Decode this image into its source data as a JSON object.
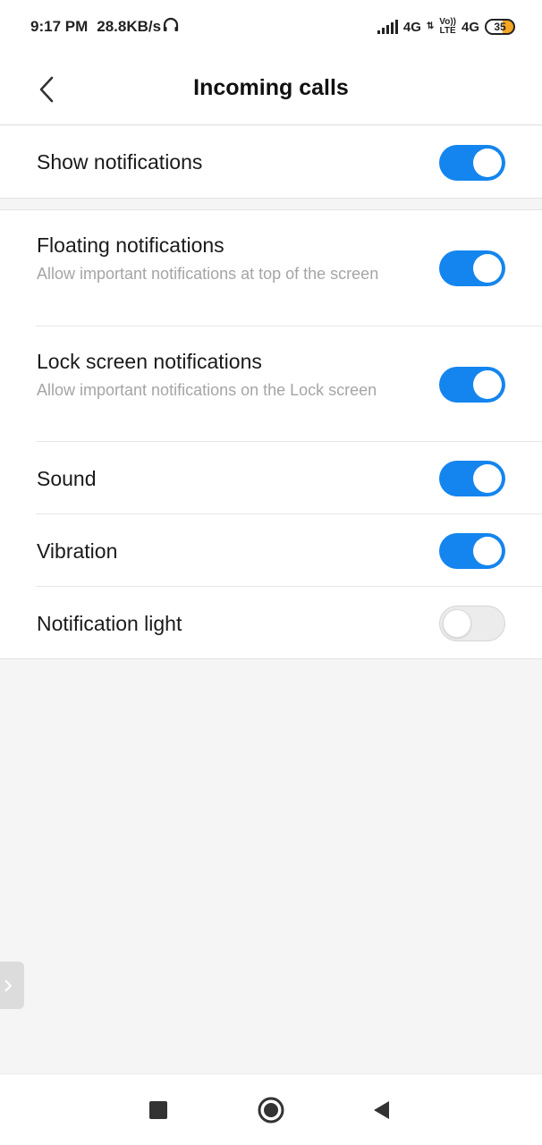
{
  "status_bar": {
    "time": "9:17 PM",
    "speed": "28.8KB/s",
    "headphone_icon": "headphone-icon",
    "network1": "4G",
    "volte_top": "Vo))",
    "volte_bottom": "LTE",
    "network2": "4G",
    "battery": "35"
  },
  "header": {
    "title": "Incoming calls",
    "back_icon": "chevron-left-icon"
  },
  "settings": {
    "show_notifications": {
      "title": "Show notifications",
      "enabled": true
    },
    "floating": {
      "title": "Floating notifications",
      "subtitle": "Allow important notifications at top of the screen",
      "enabled": true
    },
    "lock_screen": {
      "title": "Lock screen notifications",
      "subtitle": "Allow important notifications on the Lock screen",
      "enabled": true
    },
    "sound": {
      "title": "Sound",
      "enabled": true
    },
    "vibration": {
      "title": "Vibration",
      "enabled": true
    },
    "notification_light": {
      "title": "Notification light",
      "enabled": false
    }
  },
  "colors": {
    "toggle_on": "#1485ee",
    "toggle_off": "#ececec",
    "background": "#f5f5f5"
  },
  "nav_bar": {
    "recents_icon": "square-icon",
    "home_icon": "circle-icon",
    "back_icon": "triangle-back-icon"
  }
}
